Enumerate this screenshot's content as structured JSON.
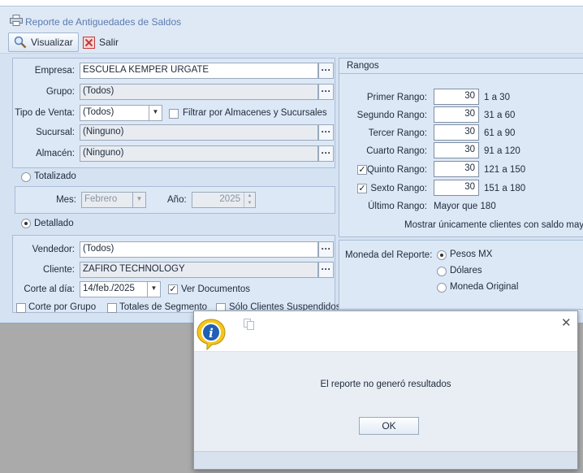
{
  "window": {
    "title": "Reporte de Antiguedades de Saldos"
  },
  "toolbar": {
    "visualizar": "Visualizar",
    "salir": "Salir"
  },
  "form": {
    "empresa_label": "Empresa:",
    "empresa_value": "ESCUELA KEMPER URGATE",
    "grupo_label": "Grupo:",
    "grupo_value": "(Todos)",
    "tipo_venta_label": "Tipo de Venta:",
    "tipo_venta_value": "(Todos)",
    "filtrar_label": "Filtrar por Almacenes y Sucursales",
    "sucursal_label": "Sucursal:",
    "sucursal_value": "(Ninguno)",
    "almacen_label": "Almacén:",
    "almacen_value": "(Ninguno)",
    "totalizado_label": "Totalizado",
    "mes_label": "Mes:",
    "mes_value": "Febrero",
    "anio_label": "Año:",
    "anio_value": "2025",
    "detallado_label": "Detallado",
    "vendedor_label": "Vendedor:",
    "vendedor_value": "(Todos)",
    "cliente_label": "Cliente:",
    "cliente_value": "ZAFIRO TECHNOLOGY",
    "corte_label": "Corte al día:",
    "corte_value": "14/feb./2025",
    "ver_documentos_label": "Ver Documentos",
    "corte_grupo_label": "Corte por Grupo",
    "totales_segmento_label": "Totales de Segmento",
    "solo_suspendidos_label": "Sólo Clientes Suspendidos",
    "ellipsis": "···"
  },
  "rangos": {
    "title": "Rangos",
    "rows": [
      {
        "label": "Primer Rango:",
        "value": "30",
        "range": "1 a 30"
      },
      {
        "label": "Segundo Rango:",
        "value": "30",
        "range": "31 a 60"
      },
      {
        "label": "Tercer Rango:",
        "value": "30",
        "range": "61 a 90"
      },
      {
        "label": "Cuarto Rango:",
        "value": "30",
        "range": "91 a 120"
      },
      {
        "label": "Quinto Rango:",
        "value": "30",
        "range": "121 a 150"
      },
      {
        "label": "Sexto Rango:",
        "value": "30",
        "range": "151 a 180"
      }
    ],
    "ultimo_label": "Último Rango:",
    "ultimo_value": "Mayor que 180",
    "mostrar_label": "Mostrar únicamente clientes con saldo mayor a"
  },
  "moneda": {
    "label": "Moneda del Reporte:",
    "options": [
      "Pesos MX",
      "Dólares",
      "Moneda Original"
    ],
    "selected": "Pesos MX"
  },
  "dialog": {
    "message": "El reporte no generó resultados",
    "ok": "OK",
    "close": "✕"
  }
}
